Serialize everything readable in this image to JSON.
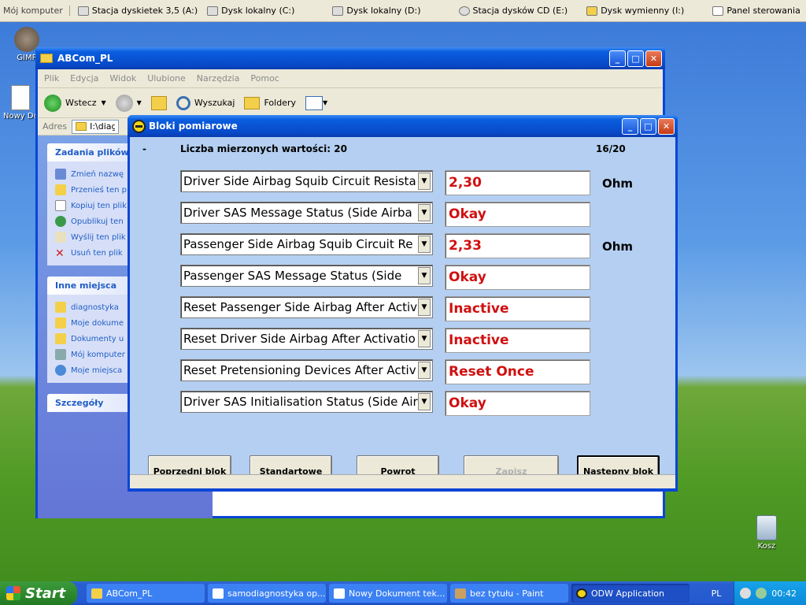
{
  "quickbar": {
    "items": [
      {
        "label": "Mój komputer"
      },
      {
        "label": "Stacja dyskietek 3,5 (A:)"
      },
      {
        "label": "Dysk lokalny (C:)"
      },
      {
        "label": "Dysk lokalny (D:)"
      },
      {
        "label": "Stacja dysków CD (E:)"
      },
      {
        "label": "Dysk wymienny (I:)"
      },
      {
        "label": "Panel sterowania"
      }
    ]
  },
  "desktop": {
    "icons": [
      {
        "label": "GIMP"
      },
      {
        "label": "Nowy Dokum"
      },
      {
        "label": "Kosz"
      }
    ]
  },
  "explorer": {
    "title": "ABCom_PL",
    "menu": [
      "Plik",
      "Edycja",
      "Widok",
      "Ulubione",
      "Narzędzia",
      "Pomoc"
    ],
    "toolbar": {
      "back": "Wstecz",
      "search": "Wyszukaj",
      "folders": "Foldery"
    },
    "address_label": "Adres",
    "address_value": "I:\\diagnost",
    "tasks_panel": {
      "title": "Zadania plików",
      "items": [
        "Zmień nazwę",
        "Przenieś ten p",
        "Kopiuj ten plik",
        "Opublikuj ten",
        "Wyślij ten plik",
        "Usuń ten plik"
      ]
    },
    "places_panel": {
      "title": "Inne miejsca",
      "items": [
        "diagnostyka",
        "Moje dokume",
        "Dokumenty u",
        "Mój komputer",
        "Moje miejsca"
      ]
    },
    "details_panel": {
      "title": "Szczegóły"
    }
  },
  "dialog": {
    "title": "Bloki pomiarowe",
    "dash": "-",
    "count_label": "Liczba mierzonych wartości: 20",
    "page": "16/20",
    "rows": [
      {
        "name": "Driver Side Airbag Squib Circuit Resista",
        "value": "2,30",
        "unit": "Ohm"
      },
      {
        "name": "Driver SAS Message Status (Side Airba",
        "value": "Okay",
        "unit": ""
      },
      {
        "name": "Passenger Side Airbag Squib Circuit Re",
        "value": "2,33",
        "unit": "Ohm"
      },
      {
        "name": "Passenger SAS Message Status (Side",
        "value": "Okay",
        "unit": ""
      },
      {
        "name": "Reset Passenger Side Airbag After Activ",
        "value": "Inactive",
        "unit": ""
      },
      {
        "name": "Reset Driver Side Airbag After Activatio",
        "value": "Inactive",
        "unit": ""
      },
      {
        "name": "Reset Pretensioning Devices After Activ",
        "value": "Reset Once",
        "unit": ""
      },
      {
        "name": "Driver SAS Initialisation Status (Side Air",
        "value": "Okay",
        "unit": ""
      }
    ],
    "buttons": {
      "prev": "Poprzedni blok",
      "standard": "Standartowe",
      "back": "Powrot",
      "save": "Zapisz",
      "next": "Następny blok"
    }
  },
  "taskbar": {
    "start": "Start",
    "tasks": [
      {
        "label": "ABCom_PL"
      },
      {
        "label": "samodiagnostyka op..."
      },
      {
        "label": "Nowy Dokument tek..."
      },
      {
        "label": "bez tytułu - Paint"
      },
      {
        "label": "ODW Application"
      }
    ],
    "lang": "PL",
    "clock": "00:42"
  }
}
